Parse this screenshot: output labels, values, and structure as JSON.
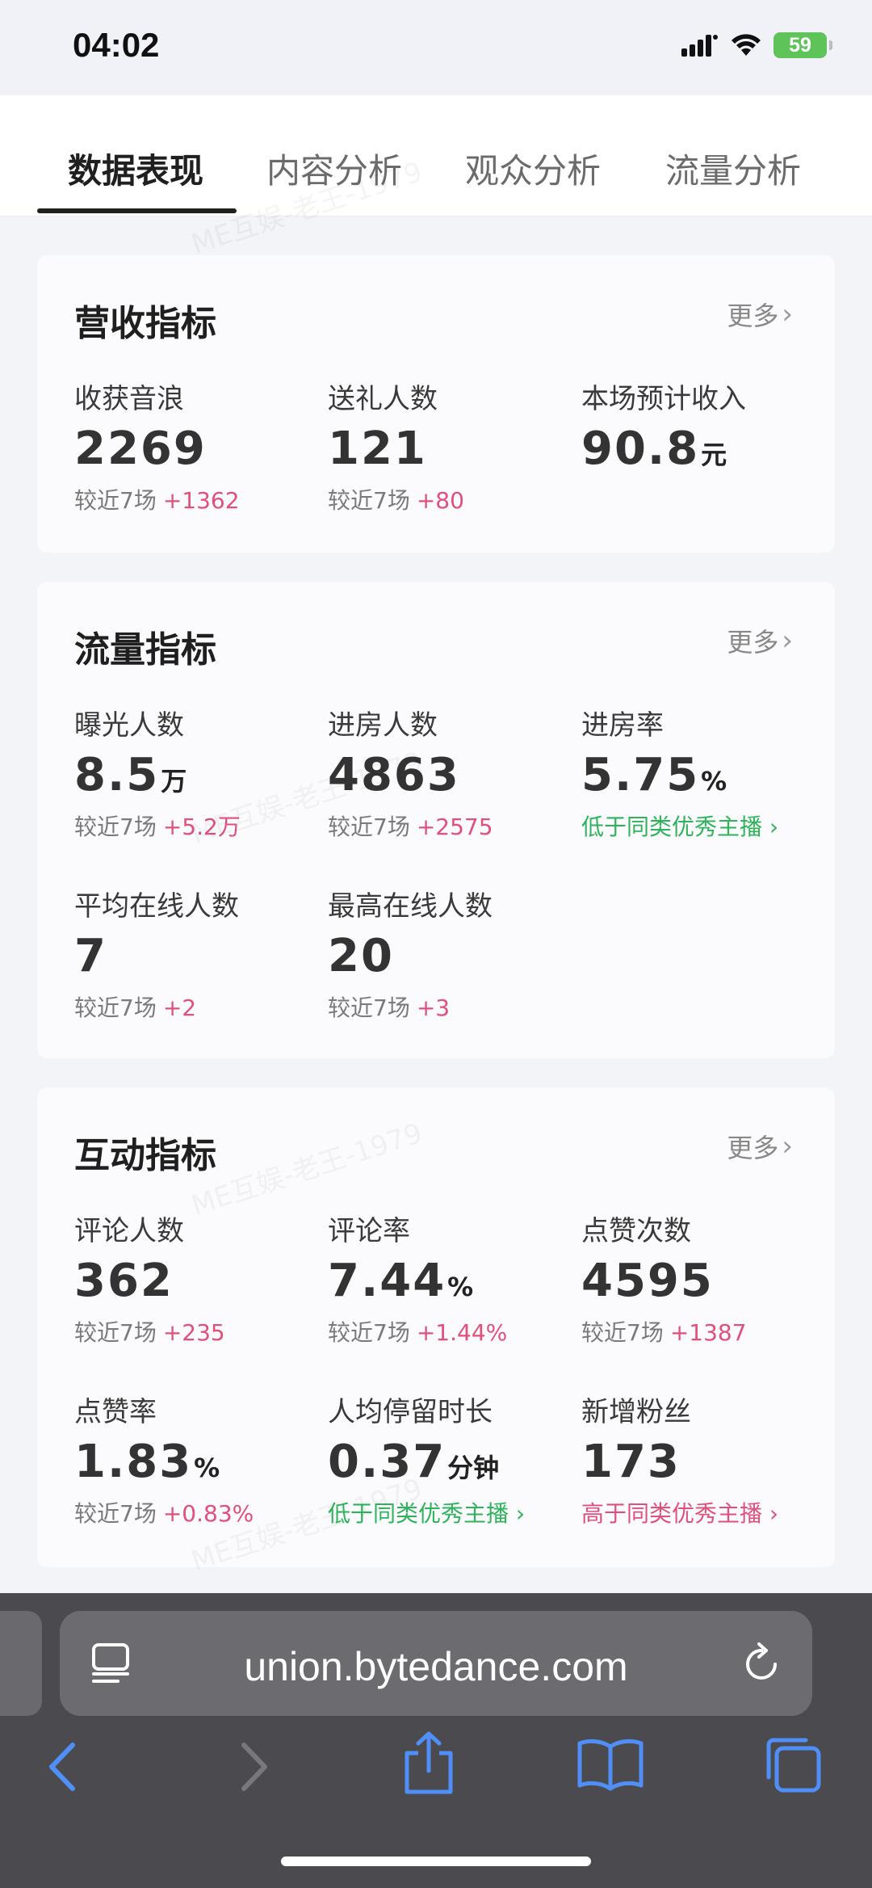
{
  "status_bar": {
    "time": "04:02",
    "battery": "59"
  },
  "tabs": [
    {
      "label": "数据表现",
      "active": true
    },
    {
      "label": "内容分析",
      "active": false
    },
    {
      "label": "观众分析",
      "active": false
    },
    {
      "label": "流量分析",
      "active": false
    }
  ],
  "revenue": {
    "title": "营收指标",
    "more": "更多",
    "metrics": [
      {
        "label": "收获音浪",
        "value": "2269",
        "compare": "较近7场",
        "delta": "+1362"
      },
      {
        "label": "送礼人数",
        "value": "121",
        "compare": "较近7场",
        "delta": "+80"
      },
      {
        "label": "本场预计收入",
        "value": "90.8",
        "unit": "元"
      }
    ]
  },
  "traffic": {
    "title": "流量指标",
    "more": "更多",
    "metrics": [
      {
        "label": "曝光人数",
        "value": "8.5",
        "unit": "万",
        "compare": "较近7场",
        "delta": "+5.2万"
      },
      {
        "label": "进房人数",
        "value": "4863",
        "compare": "较近7场",
        "delta": "+2575"
      },
      {
        "label": "进房率",
        "value": "5.75",
        "unit": "%",
        "note": "低于同类优秀主播"
      },
      {
        "label": "平均在线人数",
        "value": "7",
        "compare": "较近7场",
        "delta": "+2"
      },
      {
        "label": "最高在线人数",
        "value": "20",
        "compare": "较近7场",
        "delta": "+3"
      }
    ]
  },
  "interaction": {
    "title": "互动指标",
    "more": "更多",
    "metrics": [
      {
        "label": "评论人数",
        "value": "362",
        "compare": "较近7场",
        "delta": "+235"
      },
      {
        "label": "评论率",
        "value": "7.44",
        "unit": "%",
        "compare": "较近7场",
        "delta": "+1.44%"
      },
      {
        "label": "点赞次数",
        "value": "4595",
        "compare": "较近7场",
        "delta": "+1387"
      },
      {
        "label": "点赞率",
        "value": "1.83",
        "unit": "%",
        "compare": "较近7场",
        "delta": "+0.83%"
      },
      {
        "label": "人均停留时长",
        "value": "0.37",
        "unit": "分钟",
        "note": "低于同类优秀主播"
      },
      {
        "label": "新增粉丝",
        "value": "173",
        "note": "高于同类优秀主播"
      }
    ]
  },
  "browser": {
    "url": "union.bytedance.com"
  },
  "watermark": "ME互娱-老王-1979",
  "colors": {
    "delta_red": "#e0507a",
    "note_green": "#2eb35b",
    "browser_blue": "#4f8ff7"
  }
}
